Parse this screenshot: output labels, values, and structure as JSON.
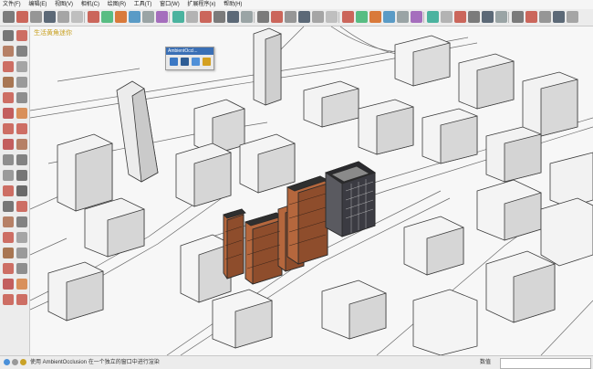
{
  "menu": [
    "文件(F)",
    "编辑(E)",
    "视图(V)",
    "相机(C)",
    "绘图(R)",
    "工具(T)",
    "窗口(W)",
    "扩展程序(x)",
    "帮助(H)"
  ],
  "viewport": {
    "scene_tag": "生活黄角迷你"
  },
  "tray": {
    "title": "AmbientOccl..."
  },
  "status": {
    "message": "使用 AmbientOcclusion 在一个独立的窗口中进行渲染",
    "measurements_label": "数值",
    "measurements_value": ""
  },
  "colors": {
    "brick": "#b5673d",
    "dark_glass": "#3b3b42",
    "toolbar": "#ececec"
  },
  "toolbar_icons": [
    "select-icon",
    "eraser-icon",
    "paint-bucket-icon",
    "pencil-icon",
    "arc-icon",
    "rectangle-icon",
    "circle-icon",
    "push-pull-icon",
    "move-icon",
    "rotate-icon",
    "follow-me-icon",
    "scale-icon",
    "offset-icon",
    "tape-measure-icon",
    "text-icon",
    "protractor-icon",
    "axes-icon",
    "section-plane-icon",
    "orbit-icon",
    "pan-icon",
    "zoom-icon",
    "zoom-extents-icon",
    "previous-view-icon",
    "next-view-icon",
    "walk-icon",
    "look-around-icon",
    "position-camera-icon",
    "components-icon",
    "materials-icon",
    "styles-icon",
    "layers-icon",
    "shadows-icon",
    "fog-icon",
    "match-photo-icon",
    "3d-warehouse-icon",
    "extension-warehouse-icon",
    "user-icon",
    "flask-icon",
    "teapot-icon",
    "sandbox-icon",
    "iso-view-icon",
    "top-view-icon",
    "front-view-icon",
    "right-view-icon",
    "back-view-icon",
    "left-view-icon",
    "x-ray-icon",
    "back-edges-icon",
    "wireframe-icon",
    "hidden-line-icon",
    "shaded-icon",
    "textured-icon"
  ]
}
